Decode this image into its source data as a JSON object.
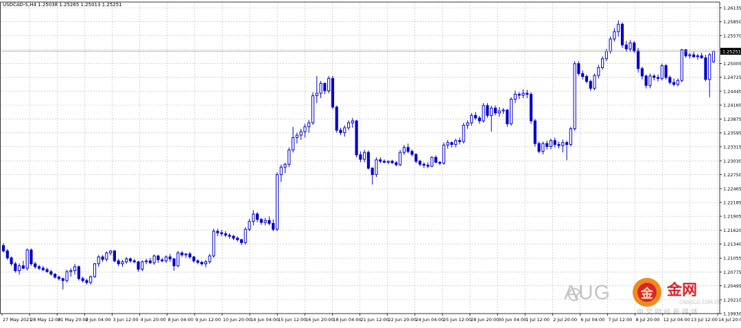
{
  "window": {
    "info_line": "USDCAD-S,H4  1.25038 1.25265 1.25013 1.25251"
  },
  "current_price_label": "1.25251",
  "watermark": {
    "brand_text": "AUG",
    "logo_glyph": "金",
    "site_title": "金网",
    "site_domain": "CNGOLD.COM.CN",
    "site_tagline": "中 文 财 经 新 媒 体"
  },
  "colors": {
    "background": "#ffffff",
    "grid": "#b4b4b4",
    "candle": "#0000cc",
    "axis_text": "#000000",
    "price_tag_bg": "#000000",
    "price_tag_text": "#ffffff",
    "watermark_gray": "#c4c4c4",
    "watermark_orange": "#f08a1c",
    "watermark_red": "#d8262c"
  },
  "chart_data": {
    "type": "candlestick",
    "symbol": "USDCAD-S",
    "timeframe": "H4",
    "ylim": [
      1.1993,
      1.2625
    ],
    "grid": true,
    "current_price": 1.25251,
    "y_ticks": [
      "1.26135",
      "1.25850",
      "1.25570",
      "1.25285",
      "1.25005",
      "1.24725",
      "1.24440",
      "1.24160",
      "1.23875",
      "1.23595",
      "1.23315",
      "1.23030",
      "1.22750",
      "1.22465",
      "1.22185",
      "1.21905",
      "1.21620",
      "1.21340",
      "1.21055",
      "1.20775",
      "1.20495",
      "1.20210",
      "1.19930"
    ],
    "x_ticks": [
      "27 May 2021",
      "28 May 12:00",
      "31 May 20:00",
      "2 Jun 04:00",
      "3 Jun 12:00",
      "4 Jun 20:00",
      "8 Jun 04:00",
      "9 Jun 12:00",
      "10 Jun 20:00",
      "14 Jun 04:00",
      "15 Jun 12:00",
      "16 Jun 20:00",
      "18 Jun 04:00",
      "21 Jun 12:00",
      "22 Jun 20:00",
      "24 Jun 04:00",
      "25 Jun 12:00",
      "28 Jun 20:00",
      "30 Jun 04:00",
      "1 Jul 12:00",
      "2 Jul 20:00",
      "6 Jul 04:00",
      "7 Jul 12:00",
      "8 Jul 20:00",
      "12 Jul 04:00",
      "13 Jul 12:00",
      "14 Jul 20:00"
    ],
    "candles": [
      [
        1.2131,
        1.2136,
        1.2117,
        1.212
      ],
      [
        1.212,
        1.2124,
        1.2102,
        1.2106
      ],
      [
        1.2106,
        1.2109,
        1.209,
        1.2094
      ],
      [
        1.2094,
        1.2098,
        1.2076,
        1.208
      ],
      [
        1.208,
        1.2095,
        1.2072,
        1.209
      ],
      [
        1.209,
        1.21,
        1.2083,
        1.2085
      ],
      [
        1.2085,
        1.2125,
        1.208,
        1.2122
      ],
      [
        1.2122,
        1.2125,
        1.209,
        1.2094
      ],
      [
        1.2094,
        1.2098,
        1.2084,
        1.2088
      ],
      [
        1.2088,
        1.2092,
        1.2081,
        1.2085
      ],
      [
        1.2085,
        1.209,
        1.2079,
        1.2082
      ],
      [
        1.2082,
        1.2086,
        1.2076,
        1.2078
      ],
      [
        1.2078,
        1.2082,
        1.207,
        1.2073
      ],
      [
        1.2073,
        1.2075,
        1.2064,
        1.2067
      ],
      [
        1.2067,
        1.207,
        1.206,
        1.2064
      ],
      [
        1.2064,
        1.2066,
        1.2042,
        1.206
      ],
      [
        1.206,
        1.2082,
        1.2056,
        1.2078
      ],
      [
        1.2078,
        1.2085,
        1.2068,
        1.208
      ],
      [
        1.208,
        1.2094,
        1.2072,
        1.2088
      ],
      [
        1.2088,
        1.2091,
        1.206,
        1.2064
      ],
      [
        1.2064,
        1.2068,
        1.2056,
        1.206
      ],
      [
        1.206,
        1.2064,
        1.2052,
        1.2056
      ],
      [
        1.2056,
        1.207,
        1.2052,
        1.2068
      ],
      [
        1.2068,
        1.2096,
        1.2065,
        1.2094
      ],
      [
        1.2094,
        1.2112,
        1.2088,
        1.2108
      ],
      [
        1.2108,
        1.2112,
        1.2098,
        1.2103
      ],
      [
        1.2103,
        1.2119,
        1.2099,
        1.2116
      ],
      [
        1.2116,
        1.2122,
        1.2111,
        1.212
      ],
      [
        1.212,
        1.2122,
        1.2097,
        1.21
      ],
      [
        1.21,
        1.2104,
        1.2089,
        1.2094
      ],
      [
        1.2094,
        1.2102,
        1.2088,
        1.2098
      ],
      [
        1.2098,
        1.2108,
        1.2094,
        1.2104
      ],
      [
        1.2104,
        1.2107,
        1.2096,
        1.21
      ],
      [
        1.21,
        1.2104,
        1.2095,
        1.2098
      ],
      [
        1.2098,
        1.21,
        1.2078,
        1.2083
      ],
      [
        1.2083,
        1.2101,
        1.2079,
        1.2098
      ],
      [
        1.2098,
        1.2104,
        1.2093,
        1.21
      ],
      [
        1.21,
        1.2106,
        1.2094,
        1.2096
      ],
      [
        1.2096,
        1.2113,
        1.2092,
        1.211
      ],
      [
        1.211,
        1.2112,
        1.2096,
        1.2102
      ],
      [
        1.2102,
        1.2106,
        1.2097,
        1.21
      ],
      [
        1.21,
        1.2111,
        1.2096,
        1.2108
      ],
      [
        1.2108,
        1.2114,
        1.2098,
        1.2104
      ],
      [
        1.2104,
        1.2106,
        1.208,
        1.209
      ],
      [
        1.209,
        1.212,
        1.2087,
        1.2116
      ],
      [
        1.2116,
        1.212,
        1.2108,
        1.2112
      ],
      [
        1.2112,
        1.2116,
        1.2106,
        1.2114
      ],
      [
        1.2114,
        1.2118,
        1.2104,
        1.2108
      ],
      [
        1.2108,
        1.211,
        1.2096,
        1.21
      ],
      [
        1.21,
        1.2103,
        1.2093,
        1.2097
      ],
      [
        1.2097,
        1.21,
        1.209,
        1.2094
      ],
      [
        1.2094,
        1.2102,
        1.2087,
        1.2098
      ],
      [
        1.2098,
        1.2114,
        1.2094,
        1.211
      ],
      [
        1.211,
        1.2165,
        1.2106,
        1.216
      ],
      [
        1.216,
        1.2165,
        1.215,
        1.2157
      ],
      [
        1.2157,
        1.2163,
        1.215,
        1.2155
      ],
      [
        1.2155,
        1.216,
        1.2148,
        1.2152
      ],
      [
        1.2152,
        1.2156,
        1.2145,
        1.215
      ],
      [
        1.215,
        1.2153,
        1.2142,
        1.2146
      ],
      [
        1.2146,
        1.215,
        1.2139,
        1.2143
      ],
      [
        1.2143,
        1.2145,
        1.2132,
        1.2137
      ],
      [
        1.2137,
        1.2168,
        1.2133,
        1.2164
      ],
      [
        1.2164,
        1.2185,
        1.216,
        1.218
      ],
      [
        1.218,
        1.2203,
        1.2172,
        1.2195
      ],
      [
        1.2195,
        1.2199,
        1.2178,
        1.2184
      ],
      [
        1.2184,
        1.2187,
        1.2173,
        1.2178
      ],
      [
        1.2178,
        1.2187,
        1.2172,
        1.2182
      ],
      [
        1.2182,
        1.219,
        1.2172,
        1.2176
      ],
      [
        1.2176,
        1.2184,
        1.216,
        1.2164
      ],
      [
        1.2164,
        1.228,
        1.216,
        1.2275
      ],
      [
        1.2275,
        1.2295,
        1.226,
        1.229
      ],
      [
        1.229,
        1.2299,
        1.2278,
        1.2296
      ],
      [
        1.2296,
        1.233,
        1.229,
        1.2325
      ],
      [
        1.2325,
        1.2372,
        1.232,
        1.235
      ],
      [
        1.235,
        1.236,
        1.2338,
        1.2355
      ],
      [
        1.2355,
        1.2368,
        1.2345,
        1.2362
      ],
      [
        1.2362,
        1.2378,
        1.235,
        1.2372
      ],
      [
        1.2372,
        1.2386,
        1.236,
        1.238
      ],
      [
        1.238,
        1.2442,
        1.2376,
        1.2435
      ],
      [
        1.2435,
        1.2475,
        1.242,
        1.244
      ],
      [
        1.244,
        1.2465,
        1.243,
        1.246
      ],
      [
        1.246,
        1.2462,
        1.2438,
        1.2445
      ],
      [
        1.2445,
        1.2475,
        1.244,
        1.247
      ],
      [
        1.247,
        1.2475,
        1.2408,
        1.2412
      ],
      [
        1.2412,
        1.2415,
        1.236,
        1.2365
      ],
      [
        1.2365,
        1.237,
        1.2355,
        1.236
      ],
      [
        1.236,
        1.2375,
        1.2352,
        1.237
      ],
      [
        1.237,
        1.2385,
        1.2365,
        1.238
      ],
      [
        1.238,
        1.239,
        1.237,
        1.2384
      ],
      [
        1.2384,
        1.2386,
        1.231,
        1.2315
      ],
      [
        1.2315,
        1.2322,
        1.23,
        1.2306
      ],
      [
        1.2306,
        1.2325,
        1.23,
        1.232
      ],
      [
        1.232,
        1.2324,
        1.2285,
        1.2288
      ],
      [
        1.2288,
        1.229,
        1.2255,
        1.2275
      ],
      [
        1.2275,
        1.231,
        1.227,
        1.2305
      ],
      [
        1.2305,
        1.231,
        1.2298,
        1.2302
      ],
      [
        1.2302,
        1.2306,
        1.2298,
        1.23
      ],
      [
        1.23,
        1.2304,
        1.2296,
        1.2302
      ],
      [
        1.2302,
        1.2305,
        1.2297,
        1.2299
      ],
      [
        1.2299,
        1.2302,
        1.2292,
        1.2295
      ],
      [
        1.2295,
        1.2325,
        1.2292,
        1.232
      ],
      [
        1.232,
        1.2335,
        1.2315,
        1.233
      ],
      [
        1.233,
        1.2338,
        1.2318,
        1.2322
      ],
      [
        1.2322,
        1.2326,
        1.2312,
        1.2316
      ],
      [
        1.2316,
        1.2318,
        1.2298,
        1.2302
      ],
      [
        1.2302,
        1.2305,
        1.2292,
        1.2296
      ],
      [
        1.2296,
        1.23,
        1.2288,
        1.2294
      ],
      [
        1.2294,
        1.23,
        1.2288,
        1.2292
      ],
      [
        1.2292,
        1.2312,
        1.229,
        1.231
      ],
      [
        1.231,
        1.2314,
        1.2298,
        1.23
      ],
      [
        1.23,
        1.2302,
        1.2294,
        1.2298
      ],
      [
        1.2298,
        1.234,
        1.2295,
        1.2335
      ],
      [
        1.2335,
        1.2345,
        1.2328,
        1.234
      ],
      [
        1.234,
        1.2342,
        1.233,
        1.2336
      ],
      [
        1.2336,
        1.2348,
        1.233,
        1.2344
      ],
      [
        1.2344,
        1.235,
        1.2336,
        1.2342
      ],
      [
        1.2342,
        1.238,
        1.2338,
        1.2375
      ],
      [
        1.2375,
        1.2385,
        1.2368,
        1.238
      ],
      [
        1.238,
        1.24,
        1.2374,
        1.2395
      ],
      [
        1.2395,
        1.2402,
        1.2386,
        1.239
      ],
      [
        1.239,
        1.2394,
        1.2378,
        1.2384
      ],
      [
        1.2384,
        1.242,
        1.238,
        1.2415
      ],
      [
        1.2415,
        1.242,
        1.239,
        1.2395
      ],
      [
        1.2395,
        1.2415,
        1.2362,
        1.241
      ],
      [
        1.241,
        1.2415,
        1.2395,
        1.24
      ],
      [
        1.24,
        1.2412,
        1.2392,
        1.2404
      ],
      [
        1.2404,
        1.241,
        1.2398,
        1.2406
      ],
      [
        1.2406,
        1.2408,
        1.2372,
        1.2378
      ],
      [
        1.2378,
        1.2432,
        1.2374,
        1.2428
      ],
      [
        1.2428,
        1.2445,
        1.242,
        1.2438
      ],
      [
        1.2438,
        1.2442,
        1.2428,
        1.2436
      ],
      [
        1.2436,
        1.2448,
        1.243,
        1.244
      ],
      [
        1.244,
        1.2447,
        1.243,
        1.2438
      ],
      [
        1.2438,
        1.2442,
        1.2378,
        1.2384
      ],
      [
        1.2384,
        1.2388,
        1.2332,
        1.2338
      ],
      [
        1.2338,
        1.2342,
        1.2318,
        1.2322
      ],
      [
        1.2322,
        1.2342,
        1.2316,
        1.2338
      ],
      [
        1.2338,
        1.2344,
        1.2326,
        1.2332
      ],
      [
        1.2332,
        1.2348,
        1.2326,
        1.2344
      ],
      [
        1.2344,
        1.235,
        1.233,
        1.2336
      ],
      [
        1.2336,
        1.2342,
        1.2328,
        1.2334
      ],
      [
        1.2334,
        1.2346,
        1.232,
        1.234
      ],
      [
        1.234,
        1.2344,
        1.2304,
        1.2336
      ],
      [
        1.2336,
        1.2372,
        1.2332,
        1.2368
      ],
      [
        1.2368,
        1.2505,
        1.2364,
        1.25
      ],
      [
        1.25,
        1.2505,
        1.2476,
        1.248
      ],
      [
        1.248,
        1.2486,
        1.2468,
        1.2474
      ],
      [
        1.2474,
        1.2478,
        1.246,
        1.2464
      ],
      [
        1.2464,
        1.2468,
        1.2445,
        1.245
      ],
      [
        1.245,
        1.248,
        1.2446,
        1.2476
      ],
      [
        1.2476,
        1.2498,
        1.247,
        1.2492
      ],
      [
        1.2492,
        1.2515,
        1.2488,
        1.251
      ],
      [
        1.251,
        1.253,
        1.2505,
        1.2525
      ],
      [
        1.2525,
        1.2555,
        1.252,
        1.255
      ],
      [
        1.255,
        1.2572,
        1.2545,
        1.2565
      ],
      [
        1.2565,
        1.2588,
        1.2555,
        1.258
      ],
      [
        1.258,
        1.2584,
        1.2532,
        1.2538
      ],
      [
        1.2538,
        1.2546,
        1.2524,
        1.253
      ],
      [
        1.253,
        1.2548,
        1.2524,
        1.2542
      ],
      [
        1.2542,
        1.2546,
        1.2522,
        1.2526
      ],
      [
        1.2526,
        1.2532,
        1.2482,
        1.249
      ],
      [
        1.249,
        1.2494,
        1.2468,
        1.2475
      ],
      [
        1.2475,
        1.2478,
        1.245,
        1.2456
      ],
      [
        1.2456,
        1.248,
        1.245,
        1.2475
      ],
      [
        1.2475,
        1.2479,
        1.2466,
        1.2472
      ],
      [
        1.2472,
        1.2478,
        1.2464,
        1.247
      ],
      [
        1.247,
        1.25,
        1.2466,
        1.2496
      ],
      [
        1.2496,
        1.2499,
        1.2468,
        1.2472
      ],
      [
        1.2472,
        1.2476,
        1.2458,
        1.2462
      ],
      [
        1.2462,
        1.247,
        1.2454,
        1.2458
      ],
      [
        1.2458,
        1.247,
        1.2454,
        1.2466
      ],
      [
        1.2466,
        1.253,
        1.2462,
        1.2528
      ],
      [
        1.2528,
        1.253,
        1.2512,
        1.2516
      ],
      [
        1.2516,
        1.2522,
        1.251,
        1.2518
      ],
      [
        1.2518,
        1.2524,
        1.2512,
        1.2514
      ],
      [
        1.2514,
        1.252,
        1.2508,
        1.2516
      ],
      [
        1.2516,
        1.2522,
        1.251,
        1.2512
      ],
      [
        1.2512,
        1.2518,
        1.2464,
        1.2468
      ],
      [
        1.2468,
        1.2522,
        1.2432,
        1.2518
      ],
      [
        1.25038,
        1.25265,
        1.25013,
        1.25251
      ]
    ]
  }
}
